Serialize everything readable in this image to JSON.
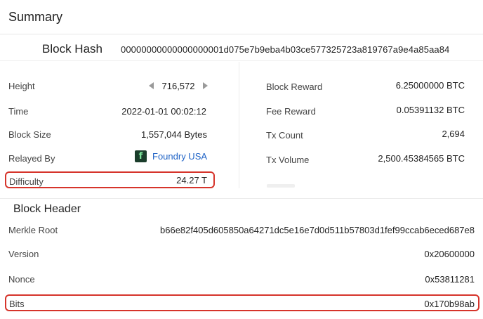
{
  "summary": {
    "title": "Summary",
    "block_hash_label": "Block Hash",
    "block_hash_value": "00000000000000000001d075e7b9eba4b03ce577325723a819767a9e4a85aa84",
    "left": {
      "height_label": "Height",
      "height_value": "716,572",
      "time_label": "Time",
      "time_value": "2022-01-01 00:02:12",
      "size_label": "Block Size",
      "size_value": "1,557,044 Bytes",
      "relayed_label": "Relayed By",
      "relayed_icon": "foundry-logo-icon",
      "relayed_logo_letter": "f",
      "relayed_value": "Foundry USA",
      "difficulty_label": "Difficulty",
      "difficulty_value": "24.27 T"
    },
    "right": {
      "reward_label": "Block Reward",
      "reward_value": "6.25000000 BTC",
      "fee_label": "Fee Reward",
      "fee_value": "0.05391132 BTC",
      "txcount_label": "Tx Count",
      "txcount_value": "2,694",
      "txvolume_label": "Tx Volume",
      "txvolume_value": "2,500.45384565 BTC"
    }
  },
  "header": {
    "title": "Block Header",
    "merkle_label": "Merkle Root",
    "merkle_value": "b66e82f405d605850a64271dc5e16e7d0d511b57803d1fef99ccab6eced687e8",
    "version_label": "Version",
    "version_value": "0x20600000",
    "nonce_label": "Nonce",
    "nonce_value": "0x53811281",
    "bits_label": "Bits",
    "bits_value": "0x170b98ab"
  },
  "colors": {
    "highlight": "#d6342b",
    "link": "#1f63c6",
    "pool_logo_bg": "#1a3d2b"
  }
}
